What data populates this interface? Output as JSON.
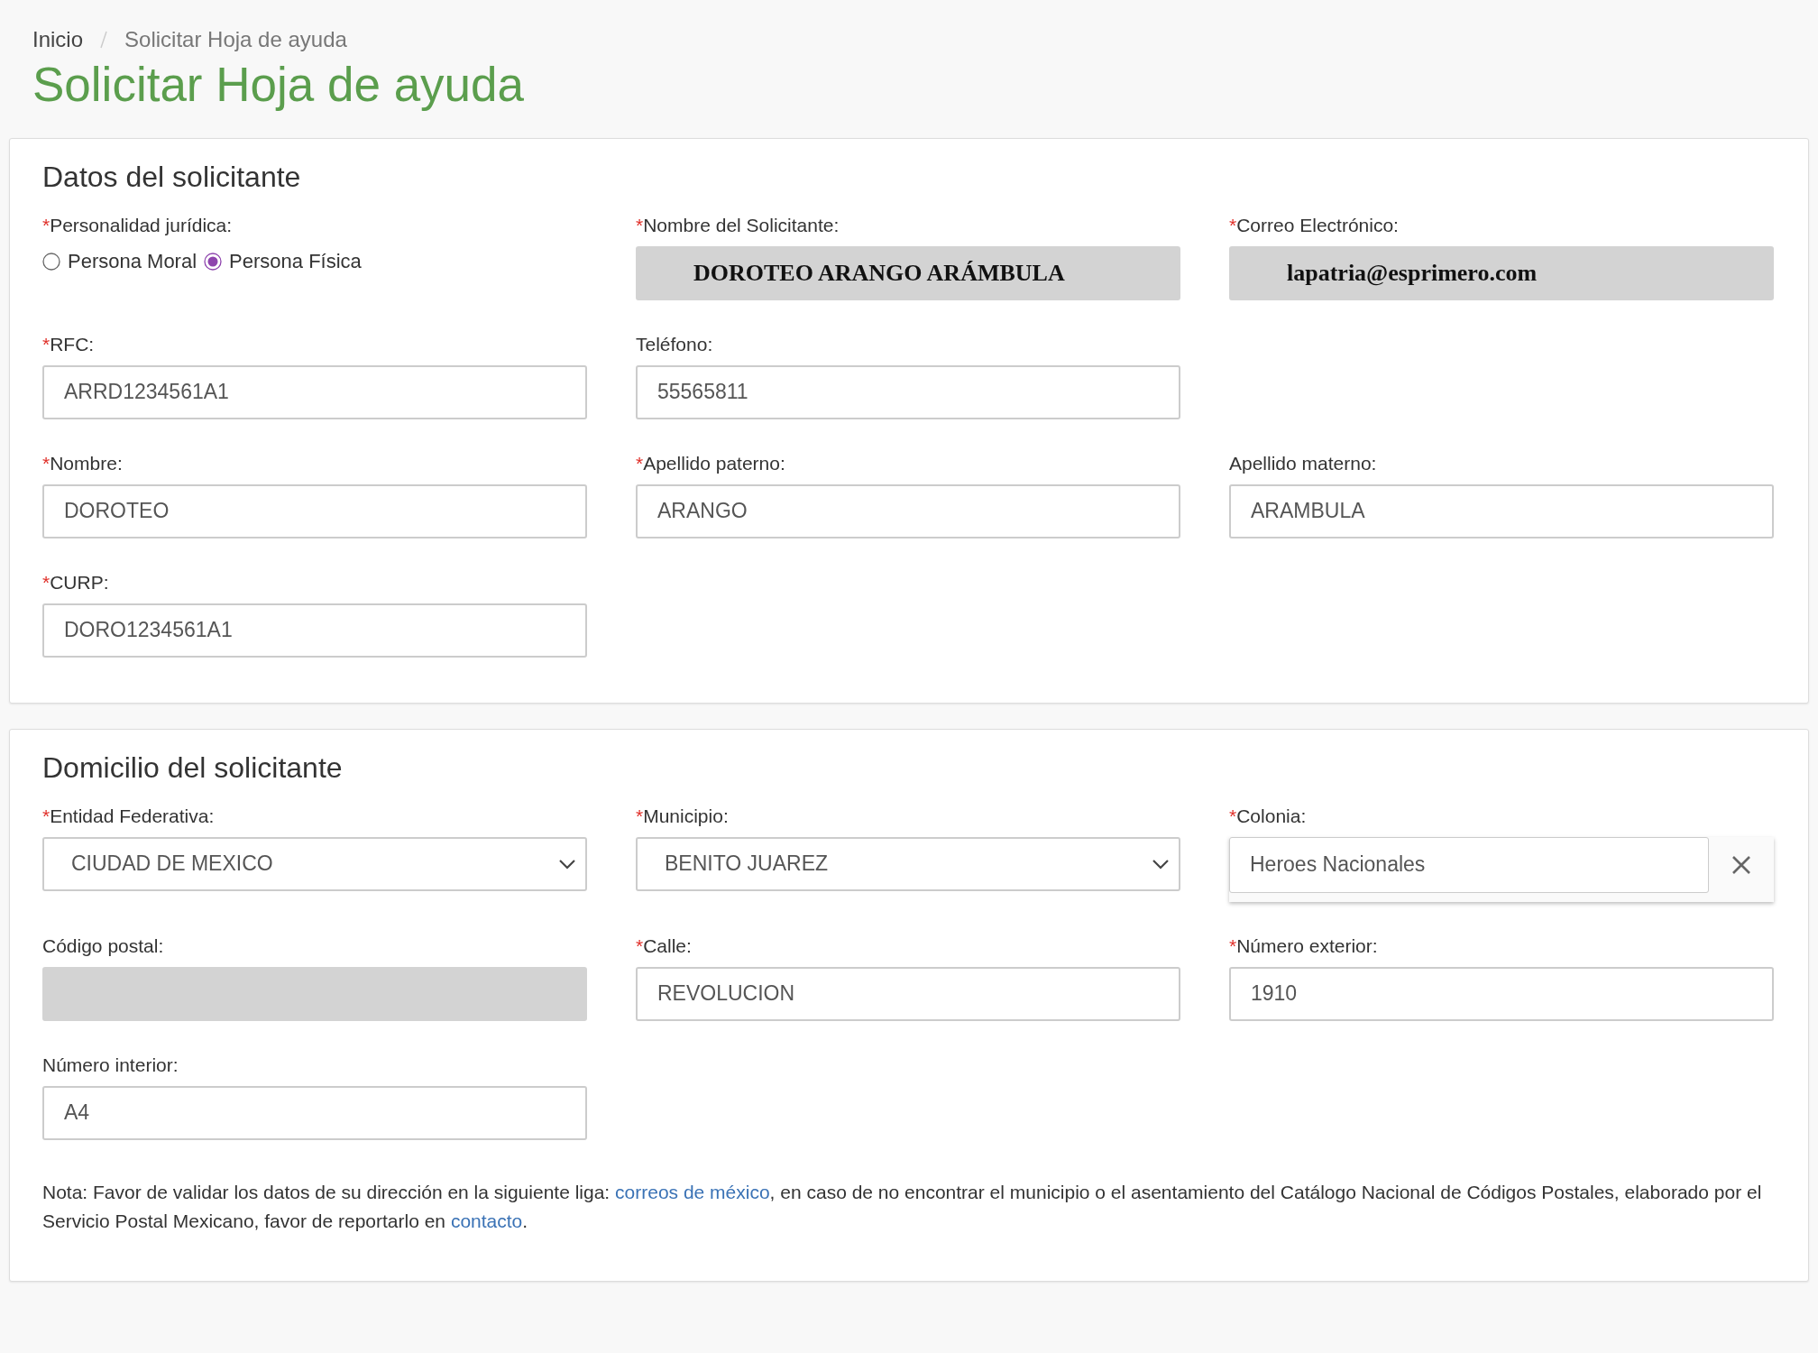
{
  "breadcrumb": [
    {
      "label": "Inicio",
      "kind": "link"
    },
    {
      "label": "Solicitar Hoja de ayuda",
      "kind": "current"
    }
  ],
  "page_title": "Solicitar Hoja de ayuda",
  "sections": [
    {
      "title": "Datos del solicitante",
      "rows": [
        [
          {
            "kind": "radio",
            "mark": "*",
            "label": "Personalidad jurídica:",
            "options": [
              {
                "label": "Persona Moral",
                "selected": false
              },
              {
                "label": "Persona Física",
                "selected": true
              }
            ]
          },
          {
            "kind": "readonly",
            "mark": "*",
            "label": "Nombre del Solicitante:",
            "value": "DOROTEO ARANGO ARÁMBULA"
          },
          {
            "kind": "readonly",
            "mark": "*",
            "label": "Correo Electrónico:",
            "value": "lapatria@esprimero.com"
          }
        ],
        [
          {
            "kind": "text",
            "mark": "*",
            "label": "RFC:",
            "value": "ARRD1234561A1"
          },
          {
            "kind": "text",
            "label": "Teléfono:",
            "value": "55565811"
          }
        ],
        [
          {
            "kind": "text",
            "mark": "*",
            "label": "Nombre:",
            "value": "DOROTEO"
          },
          {
            "kind": "text",
            "mark": "*",
            "label": "Apellido paterno:",
            "value": "ARANGO"
          },
          {
            "kind": "text",
            "label": "Apellido materno:",
            "value": "ARAMBULA"
          }
        ],
        [
          {
            "kind": "text",
            "mark": "*",
            "label": "CURP:",
            "value": "DORO1234561A1"
          }
        ]
      ]
    },
    {
      "title": "Domicilio del solicitante",
      "rows": [
        [
          {
            "kind": "select",
            "mark": "*",
            "label": "Entidad Federativa:",
            "value": "CIUDAD DE MEXICO"
          },
          {
            "kind": "select",
            "mark": "*",
            "label": "Municipio:",
            "value": "BENITO JUAREZ"
          },
          {
            "kind": "clearable",
            "mark": "*",
            "label": "Colonia:",
            "value": "Heroes Nacionales"
          }
        ],
        [
          {
            "kind": "disabled",
            "label": "Código postal:"
          },
          {
            "kind": "text",
            "mark": "*",
            "label": "Calle:",
            "value": "REVOLUCION"
          },
          {
            "kind": "text",
            "mark": "*",
            "label": "Número exterior:",
            "value": "1910"
          }
        ],
        [
          {
            "kind": "text",
            "label": "Número interior:",
            "value": "A4"
          }
        ]
      ],
      "note": [
        {
          "kind": "text",
          "text": "Nota: Favor de validar los datos de su dirección en la siguiente liga: "
        },
        {
          "kind": "link",
          "text": "correos de méxico"
        },
        {
          "kind": "text",
          "text": ", en caso de no encontrar el municipio o el asentamiento del Catálogo Nacional de Códigos Postales, elaborado por el Servicio Postal Mexicano, favor de reportarlo en "
        },
        {
          "kind": "link",
          "text": "contacto"
        },
        {
          "kind": "text",
          "text": "."
        }
      ]
    }
  ]
}
